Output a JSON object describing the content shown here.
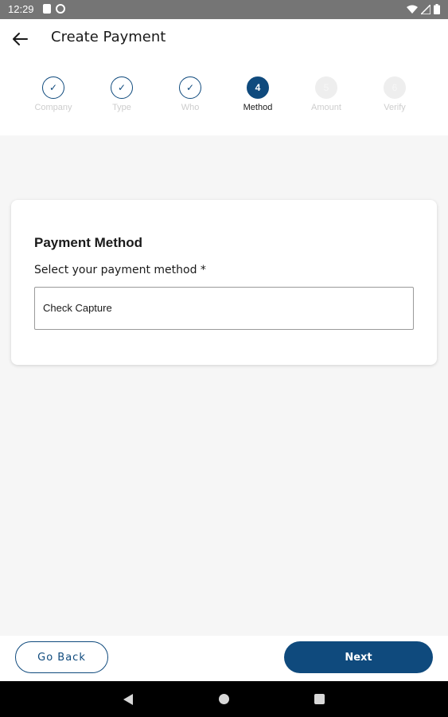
{
  "status_bar": {
    "time": "12:29",
    "icons_left": [
      "sim-card-icon",
      "sync-icon"
    ],
    "icons_right": [
      "wifi-icon",
      "signal-icon",
      "battery-icon"
    ]
  },
  "app_bar": {
    "back_icon": "arrow-left-icon",
    "title": "Create Payment"
  },
  "stepper": {
    "steps": [
      {
        "number": "1",
        "label": "Company",
        "state": "done",
        "mark": "✓"
      },
      {
        "number": "2",
        "label": "Type",
        "state": "done",
        "mark": "✓"
      },
      {
        "number": "3",
        "label": "Who",
        "state": "done",
        "mark": "✓"
      },
      {
        "number": "4",
        "label": "Method",
        "state": "active",
        "mark": "4"
      },
      {
        "number": "5",
        "label": "Amount",
        "state": "upcoming",
        "mark": "5"
      },
      {
        "number": "6",
        "label": "Verify",
        "state": "upcoming",
        "mark": "6"
      }
    ],
    "colors": {
      "active": "#0f4a7d",
      "upcoming": "#eeeeee"
    }
  },
  "card": {
    "title": "Payment Method",
    "field_label": "Select your payment method *",
    "selected_value": "Check Capture"
  },
  "actions": {
    "back_label": "Go Back",
    "next_label": "Next"
  },
  "nav_bar": {
    "icons": [
      "nav-back-icon",
      "nav-home-icon",
      "nav-recents-icon"
    ]
  },
  "colors": {
    "brand": "#0f4a7d",
    "background": "#f6f6f6",
    "status_bar": "#757575"
  }
}
